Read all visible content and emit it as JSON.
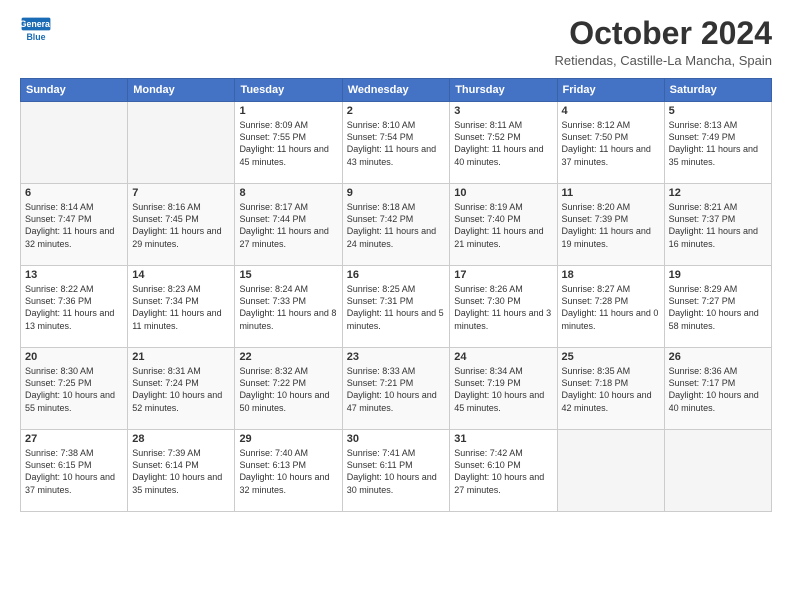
{
  "logo": {
    "line1": "General",
    "line2": "Blue"
  },
  "title": "October 2024",
  "subtitle": "Retiendas, Castille-La Mancha, Spain",
  "days_of_week": [
    "Sunday",
    "Monday",
    "Tuesday",
    "Wednesday",
    "Thursday",
    "Friday",
    "Saturday"
  ],
  "weeks": [
    [
      {
        "day": "",
        "info": ""
      },
      {
        "day": "",
        "info": ""
      },
      {
        "day": "1",
        "info": "Sunrise: 8:09 AM\nSunset: 7:55 PM\nDaylight: 11 hours and 45 minutes."
      },
      {
        "day": "2",
        "info": "Sunrise: 8:10 AM\nSunset: 7:54 PM\nDaylight: 11 hours and 43 minutes."
      },
      {
        "day": "3",
        "info": "Sunrise: 8:11 AM\nSunset: 7:52 PM\nDaylight: 11 hours and 40 minutes."
      },
      {
        "day": "4",
        "info": "Sunrise: 8:12 AM\nSunset: 7:50 PM\nDaylight: 11 hours and 37 minutes."
      },
      {
        "day": "5",
        "info": "Sunrise: 8:13 AM\nSunset: 7:49 PM\nDaylight: 11 hours and 35 minutes."
      }
    ],
    [
      {
        "day": "6",
        "info": "Sunrise: 8:14 AM\nSunset: 7:47 PM\nDaylight: 11 hours and 32 minutes."
      },
      {
        "day": "7",
        "info": "Sunrise: 8:16 AM\nSunset: 7:45 PM\nDaylight: 11 hours and 29 minutes."
      },
      {
        "day": "8",
        "info": "Sunrise: 8:17 AM\nSunset: 7:44 PM\nDaylight: 11 hours and 27 minutes."
      },
      {
        "day": "9",
        "info": "Sunrise: 8:18 AM\nSunset: 7:42 PM\nDaylight: 11 hours and 24 minutes."
      },
      {
        "day": "10",
        "info": "Sunrise: 8:19 AM\nSunset: 7:40 PM\nDaylight: 11 hours and 21 minutes."
      },
      {
        "day": "11",
        "info": "Sunrise: 8:20 AM\nSunset: 7:39 PM\nDaylight: 11 hours and 19 minutes."
      },
      {
        "day": "12",
        "info": "Sunrise: 8:21 AM\nSunset: 7:37 PM\nDaylight: 11 hours and 16 minutes."
      }
    ],
    [
      {
        "day": "13",
        "info": "Sunrise: 8:22 AM\nSunset: 7:36 PM\nDaylight: 11 hours and 13 minutes."
      },
      {
        "day": "14",
        "info": "Sunrise: 8:23 AM\nSunset: 7:34 PM\nDaylight: 11 hours and 11 minutes."
      },
      {
        "day": "15",
        "info": "Sunrise: 8:24 AM\nSunset: 7:33 PM\nDaylight: 11 hours and 8 minutes."
      },
      {
        "day": "16",
        "info": "Sunrise: 8:25 AM\nSunset: 7:31 PM\nDaylight: 11 hours and 5 minutes."
      },
      {
        "day": "17",
        "info": "Sunrise: 8:26 AM\nSunset: 7:30 PM\nDaylight: 11 hours and 3 minutes."
      },
      {
        "day": "18",
        "info": "Sunrise: 8:27 AM\nSunset: 7:28 PM\nDaylight: 11 hours and 0 minutes."
      },
      {
        "day": "19",
        "info": "Sunrise: 8:29 AM\nSunset: 7:27 PM\nDaylight: 10 hours and 58 minutes."
      }
    ],
    [
      {
        "day": "20",
        "info": "Sunrise: 8:30 AM\nSunset: 7:25 PM\nDaylight: 10 hours and 55 minutes."
      },
      {
        "day": "21",
        "info": "Sunrise: 8:31 AM\nSunset: 7:24 PM\nDaylight: 10 hours and 52 minutes."
      },
      {
        "day": "22",
        "info": "Sunrise: 8:32 AM\nSunset: 7:22 PM\nDaylight: 10 hours and 50 minutes."
      },
      {
        "day": "23",
        "info": "Sunrise: 8:33 AM\nSunset: 7:21 PM\nDaylight: 10 hours and 47 minutes."
      },
      {
        "day": "24",
        "info": "Sunrise: 8:34 AM\nSunset: 7:19 PM\nDaylight: 10 hours and 45 minutes."
      },
      {
        "day": "25",
        "info": "Sunrise: 8:35 AM\nSunset: 7:18 PM\nDaylight: 10 hours and 42 minutes."
      },
      {
        "day": "26",
        "info": "Sunrise: 8:36 AM\nSunset: 7:17 PM\nDaylight: 10 hours and 40 minutes."
      }
    ],
    [
      {
        "day": "27",
        "info": "Sunrise: 7:38 AM\nSunset: 6:15 PM\nDaylight: 10 hours and 37 minutes."
      },
      {
        "day": "28",
        "info": "Sunrise: 7:39 AM\nSunset: 6:14 PM\nDaylight: 10 hours and 35 minutes."
      },
      {
        "day": "29",
        "info": "Sunrise: 7:40 AM\nSunset: 6:13 PM\nDaylight: 10 hours and 32 minutes."
      },
      {
        "day": "30",
        "info": "Sunrise: 7:41 AM\nSunset: 6:11 PM\nDaylight: 10 hours and 30 minutes."
      },
      {
        "day": "31",
        "info": "Sunrise: 7:42 AM\nSunset: 6:10 PM\nDaylight: 10 hours and 27 minutes."
      },
      {
        "day": "",
        "info": ""
      },
      {
        "day": "",
        "info": ""
      }
    ]
  ]
}
